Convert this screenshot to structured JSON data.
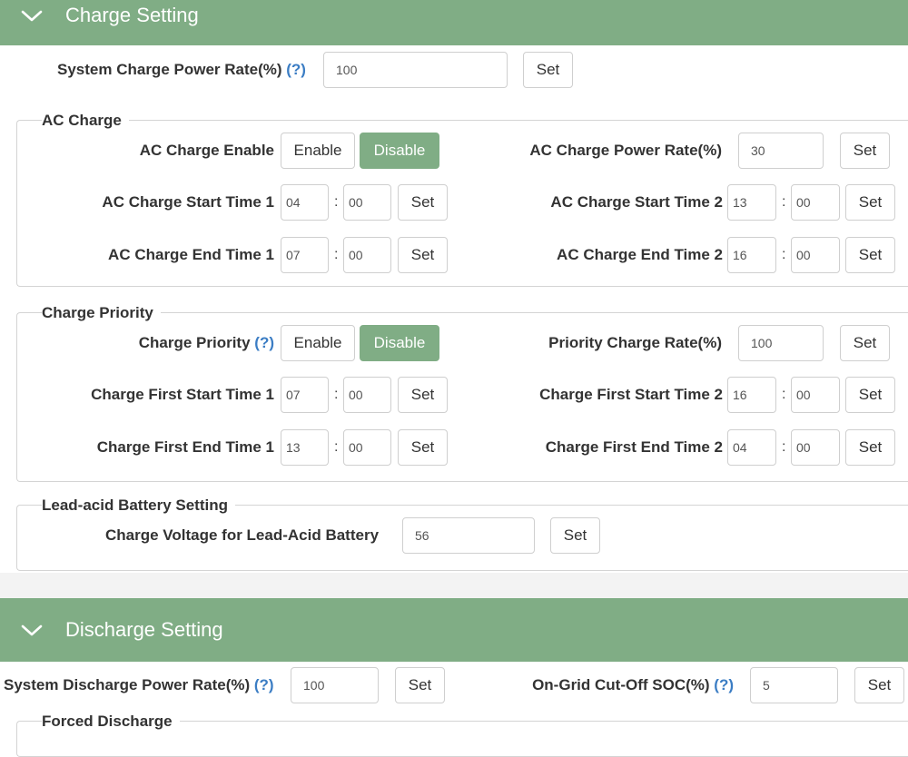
{
  "charge_section": {
    "title": "Charge Setting"
  },
  "system_charge": {
    "label": "System Charge Power Rate(%)",
    "help": "(?)",
    "value": "100",
    "set": "Set"
  },
  "ac_charge": {
    "legend": "AC Charge",
    "enable_label": "AC Charge Enable",
    "enable_btn": "Enable",
    "disable_btn": "Disable",
    "power_rate_label": "AC Charge Power Rate(%)",
    "power_rate_value": "30",
    "start1_label": "AC Charge Start Time 1",
    "start1_h": "04",
    "start1_m": "00",
    "end1_label": "AC Charge End Time 1",
    "end1_h": "07",
    "end1_m": "00",
    "start2_label": "AC Charge Start Time 2",
    "start2_h": "13",
    "start2_m": "00",
    "end2_label": "AC Charge End Time 2",
    "end2_h": "16",
    "end2_m": "00",
    "set": "Set",
    "colon": ":"
  },
  "charge_priority": {
    "legend": "Charge Priority",
    "priority_label": "Charge Priority",
    "help": "(?)",
    "enable_btn": "Enable",
    "disable_btn": "Disable",
    "rate_label": "Priority Charge Rate(%)",
    "rate_value": "100",
    "first_start1_label": "Charge First Start Time 1",
    "first_start1_h": "07",
    "first_start1_m": "00",
    "first_end1_label": "Charge First End Time 1",
    "first_end1_h": "13",
    "first_end1_m": "00",
    "first_start2_label": "Charge First Start Time 2",
    "first_start2_h": "16",
    "first_start2_m": "00",
    "first_end2_label": "Charge First End Time 2",
    "first_end2_h": "04",
    "first_end2_m": "00",
    "set": "Set",
    "colon": ":"
  },
  "lead_acid": {
    "legend": "Lead-acid Battery Setting",
    "voltage_label": "Charge Voltage for Lead-Acid Battery",
    "voltage_value": "56",
    "set": "Set"
  },
  "discharge_section": {
    "title": "Discharge Setting"
  },
  "system_discharge": {
    "label": "System Discharge Power Rate(%)",
    "help": "(?)",
    "value": "100",
    "set": "Set"
  },
  "ongrid_cutoff": {
    "label": "On-Grid Cut-Off SOC(%)",
    "help": "(?)",
    "value": "5",
    "set": "Set"
  },
  "forced_discharge": {
    "legend": "Forced Discharge"
  },
  "colors": {
    "accent": "#80ad85",
    "help": "#3b7dc4"
  }
}
